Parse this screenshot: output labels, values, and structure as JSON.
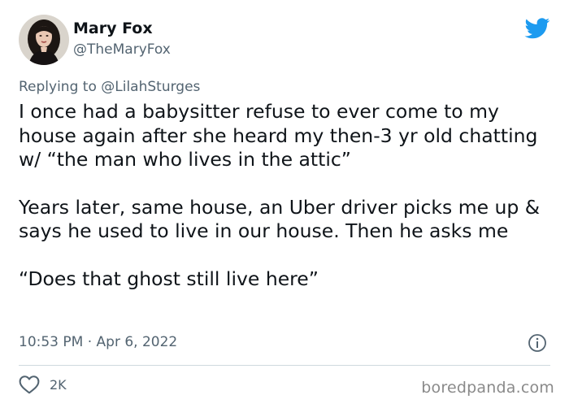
{
  "author": {
    "display_name": "Mary Fox",
    "handle": "@TheMaryFox",
    "avatar": "profile-photo"
  },
  "reply": {
    "prefix": "Replying to",
    "handle": "@LilahSturges"
  },
  "tweet": {
    "paragraphs": [
      "I once had a babysitter refuse to ever come to my house again after she heard my then-3 yr old chatting w/ “the man who lives in the attic”",
      "Years later, same house, an Uber driver picks me up & says he used to live in our house. Then he asks me",
      "“Does that ghost still live here”"
    ],
    "timestamp": "10:53 PM · Apr 6, 2022"
  },
  "actions": {
    "like_icon": "heart-icon",
    "like_count": "2K",
    "info_icon": "info-icon"
  },
  "brand": {
    "logo_icon": "twitter-bird-icon",
    "color": "#1d9bf0"
  },
  "watermark": "boredpanda.com"
}
